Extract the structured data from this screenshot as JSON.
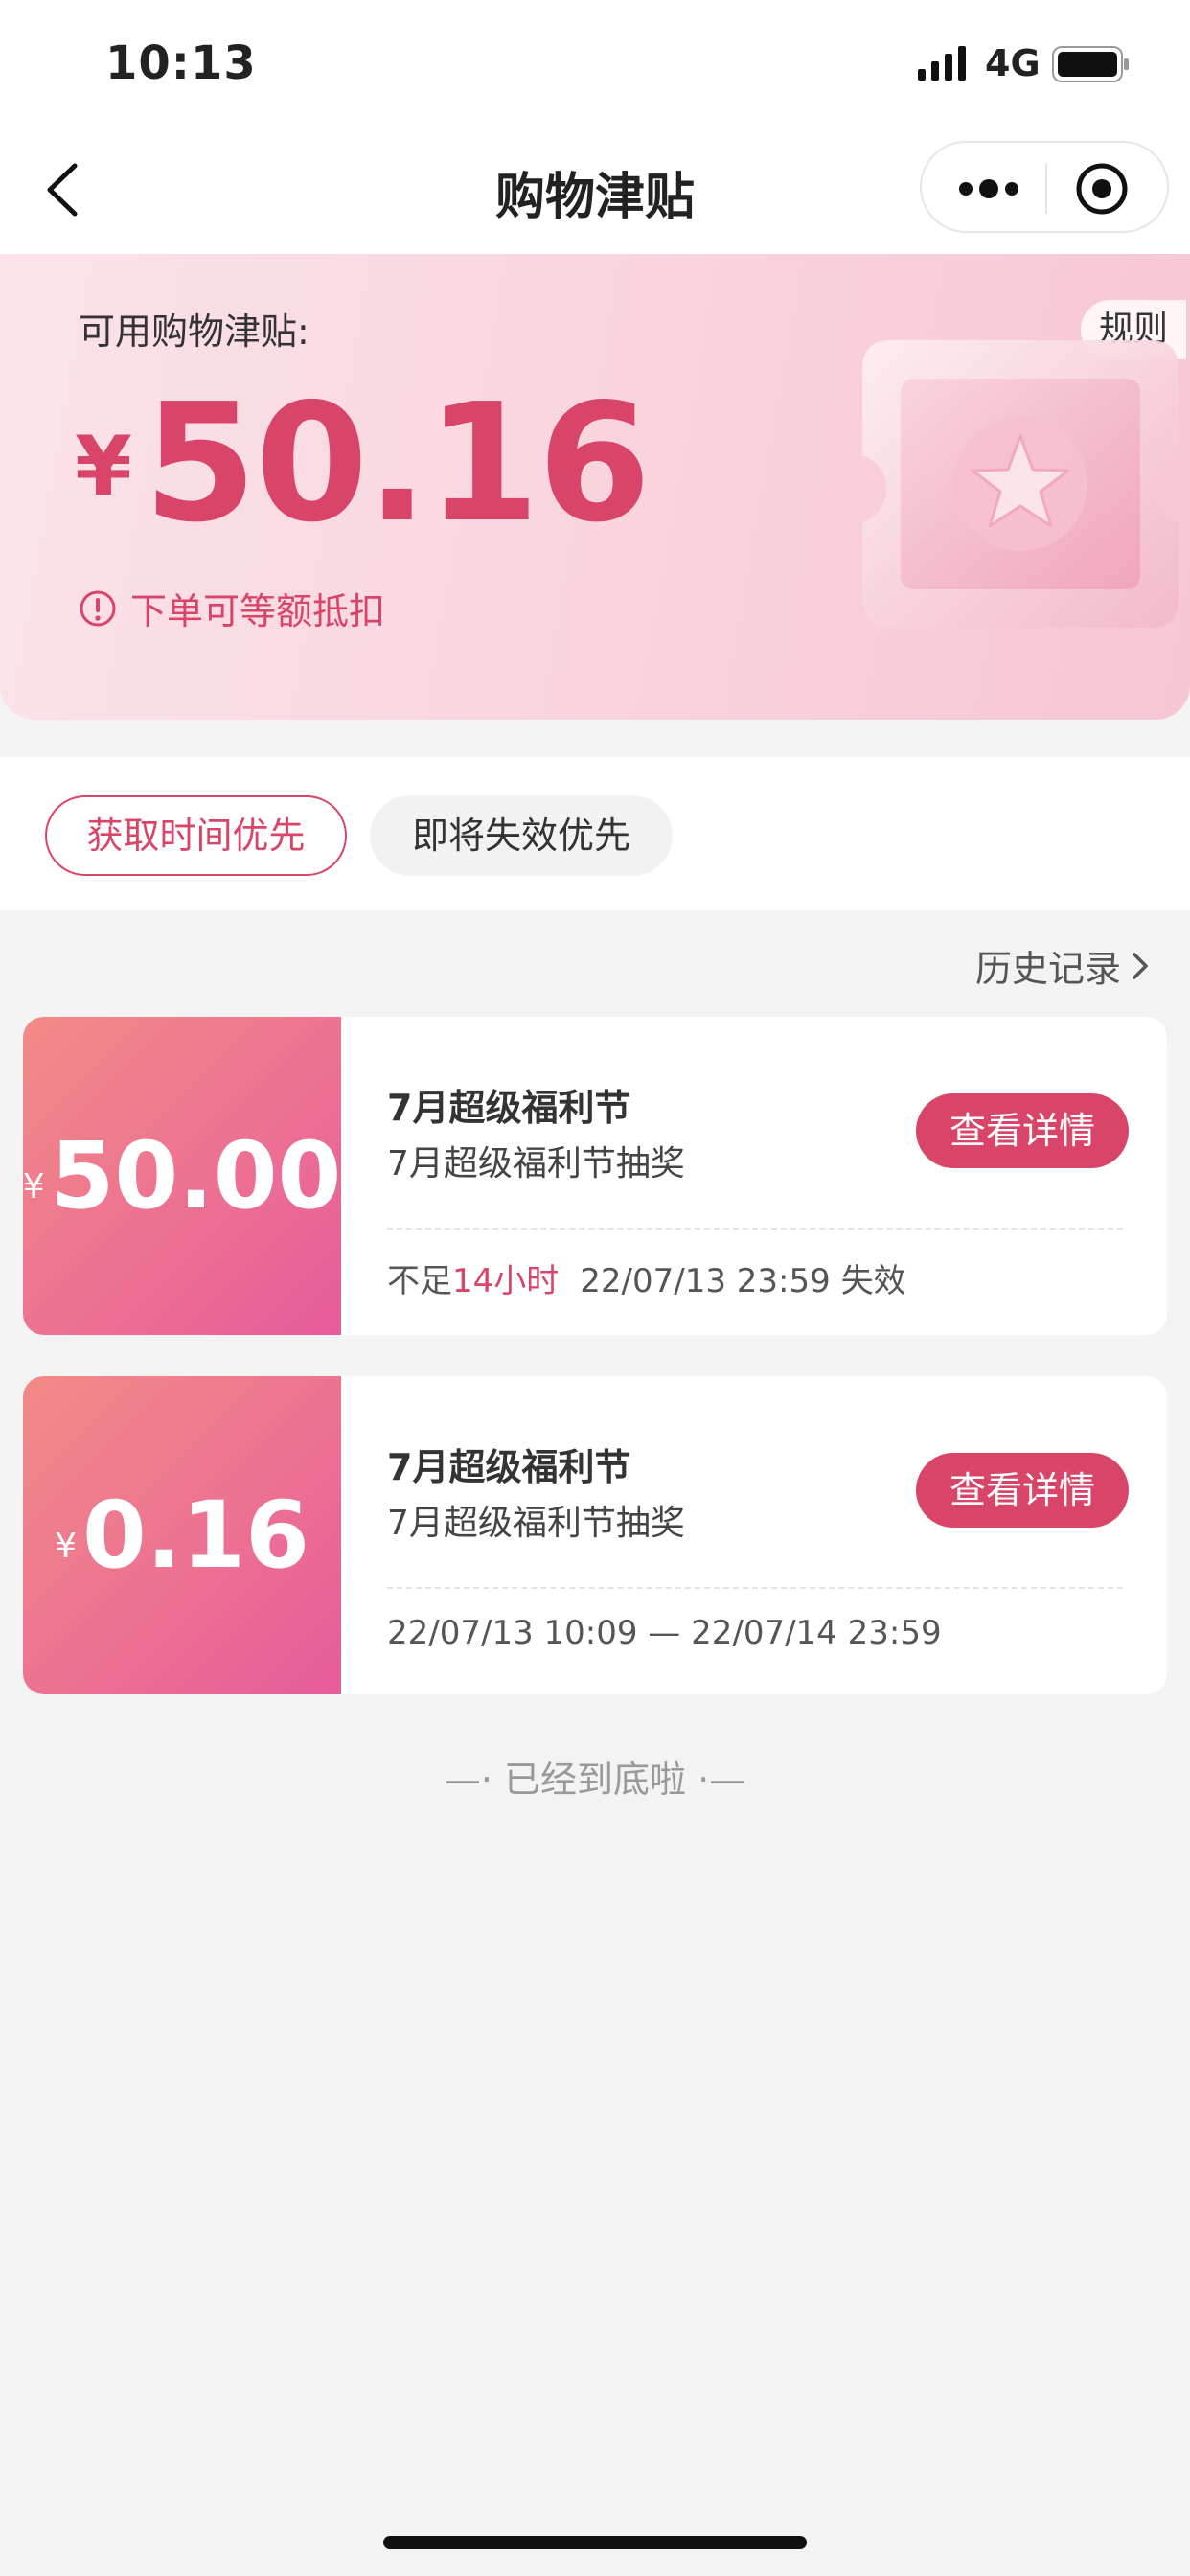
{
  "status_bar": {
    "time": "10:13",
    "network": "4G"
  },
  "nav": {
    "title": "购物津贴"
  },
  "banner": {
    "label": "可用购物津贴:",
    "rules_label": "规则",
    "currency": "¥",
    "amount": "50.16",
    "hint": "下单可等额抵扣"
  },
  "sort": {
    "tabs": [
      {
        "label": "获取时间优先"
      },
      {
        "label": "即将失效优先"
      }
    ]
  },
  "history": {
    "label": "历史记录"
  },
  "cards": [
    {
      "currency": "¥",
      "value": "50.00",
      "title": "7月超级福利节",
      "subtitle": "7月超级福利节抽奖",
      "button": "查看详情",
      "foot_prefix": "不足",
      "foot_highlight": "14小时",
      "foot_rest": "22/07/13 23:59 失效"
    },
    {
      "currency": "¥",
      "value": "0.16",
      "title": "7月超级福利节",
      "subtitle": "7月超级福利节抽奖",
      "button": "查看详情",
      "foot_rest": "22/07/13 10:09 — 22/07/14 23:59"
    }
  ],
  "end_text": "—· 已经到底啦 ·—",
  "colors": {
    "accent": "#d94469",
    "card_gradient_start": "#f28a86",
    "card_gradient_end": "#e55c9a"
  }
}
